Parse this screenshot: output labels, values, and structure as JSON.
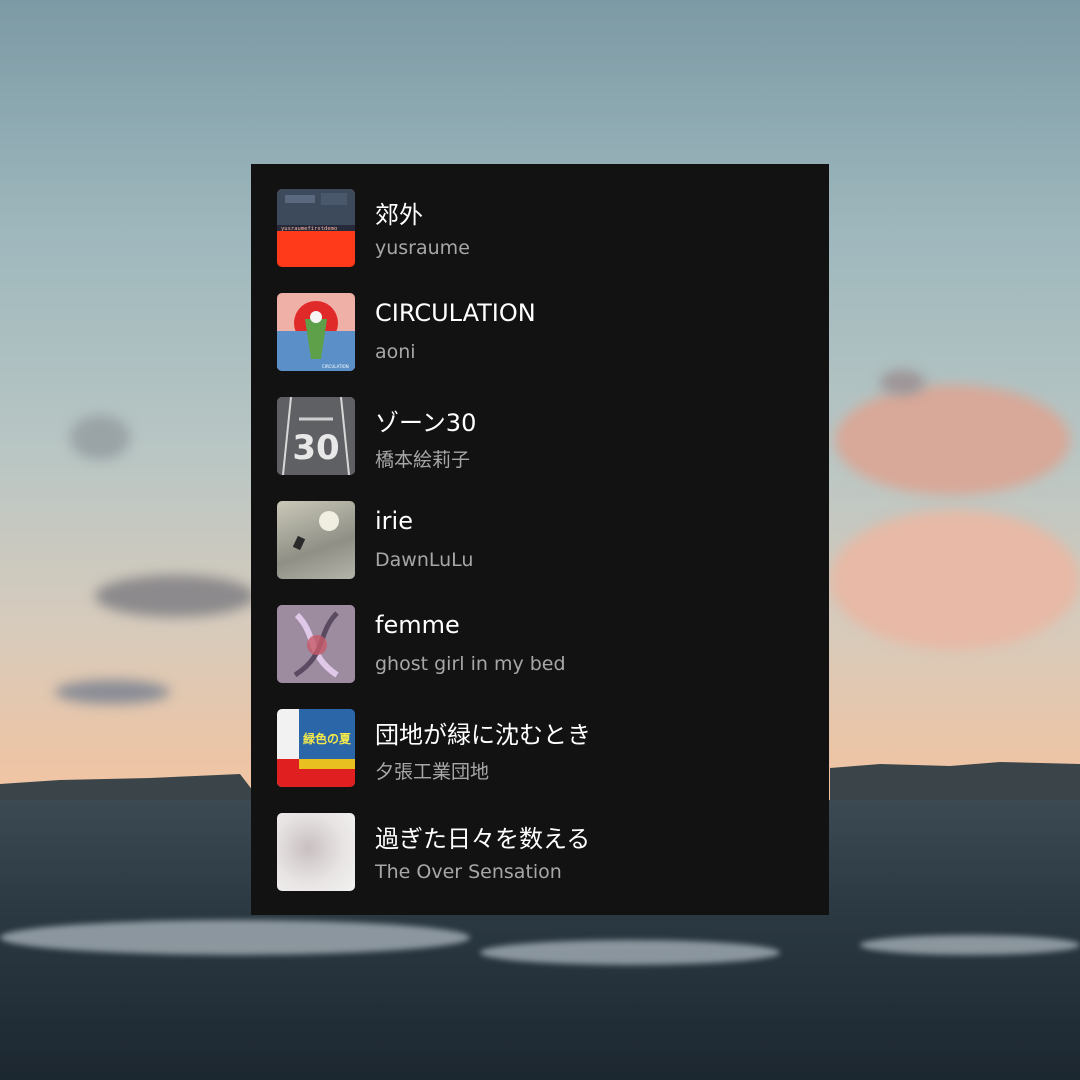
{
  "playlist": {
    "items": [
      {
        "title": "郊外",
        "artist": "yusraume"
      },
      {
        "title": "CIRCULATION",
        "artist": "aoni"
      },
      {
        "title": "ゾーン30",
        "artist": "橋本絵莉子"
      },
      {
        "title": "irie",
        "artist": "DawnLuLu"
      },
      {
        "title": "femme",
        "artist": "ghost girl in my bed"
      },
      {
        "title": "団地が緑に沈むとき",
        "artist": "夕張工業団地"
      },
      {
        "title": "過ぎた日々を数える",
        "artist": "The Over Sensation"
      }
    ]
  },
  "covers": [
    {
      "icon": "album-cover-yusraume",
      "text": "yusraumefirstdemo"
    },
    {
      "icon": "album-cover-circulation",
      "text": "CIRCULATION"
    },
    {
      "icon": "album-cover-zone30",
      "text": "30"
    },
    {
      "icon": "album-cover-irie"
    },
    {
      "icon": "album-cover-femme"
    },
    {
      "icon": "album-cover-danchi",
      "text": "緑色の夏"
    },
    {
      "icon": "album-cover-over-sensation"
    }
  ],
  "colors": {
    "panel_bg": "#121212",
    "title": "#ffffff",
    "artist": "#a7a7a7"
  }
}
